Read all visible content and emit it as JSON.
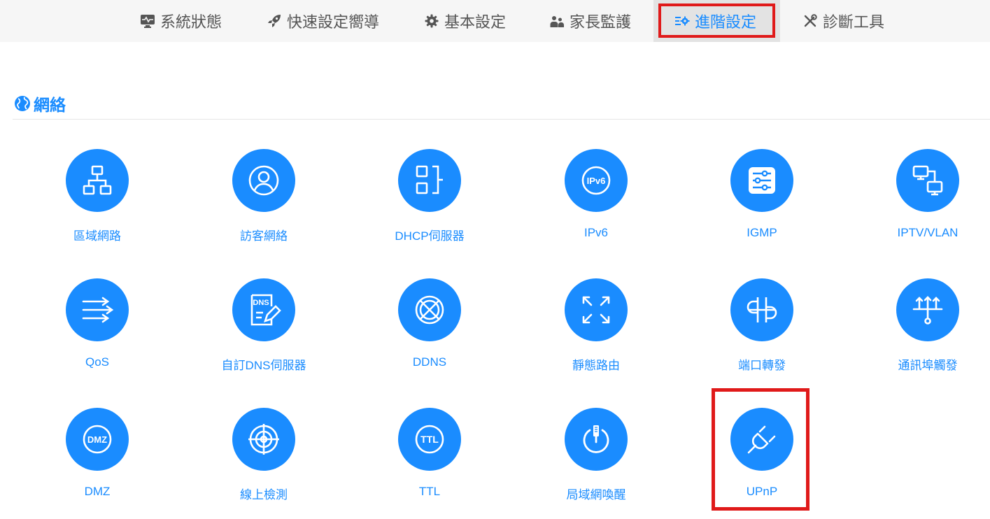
{
  "nav": {
    "items": [
      {
        "label": "系統狀態",
        "icon": "monitor-heartbeat-icon"
      },
      {
        "label": "快速設定嚮導",
        "icon": "rocket-icon"
      },
      {
        "label": "基本設定",
        "icon": "gear-icon"
      },
      {
        "label": "家長監護",
        "icon": "users-icon"
      },
      {
        "label": "進階設定",
        "icon": "advanced-settings-icon",
        "active": true
      },
      {
        "label": "診斷工具",
        "icon": "tools-icon"
      }
    ]
  },
  "section": {
    "title": "網絡",
    "icon": "globe-icon"
  },
  "tiles": [
    {
      "label": "區域網路",
      "icon": "lan-topology-icon"
    },
    {
      "label": "訪客網絡",
      "icon": "guest-user-icon"
    },
    {
      "label": "DHCP伺服器",
      "icon": "dhcp-icon"
    },
    {
      "label": "IPv6",
      "icon": "ipv6-icon",
      "badge": "IPv6"
    },
    {
      "label": "IGMP",
      "icon": "sliders-icon"
    },
    {
      "label": "IPTV/VLAN",
      "icon": "monitors-icon"
    },
    {
      "label": "QoS",
      "icon": "arrows-right-icon"
    },
    {
      "label": "自訂DNS伺服器",
      "icon": "dns-document-icon",
      "badge": "DNS"
    },
    {
      "label": "DDNS",
      "icon": "globe-grid-icon"
    },
    {
      "label": "靜態路由",
      "icon": "expand-arrows-icon"
    },
    {
      "label": "端口轉發",
      "icon": "port-forward-icon"
    },
    {
      "label": "通訊埠觸發",
      "icon": "port-trigger-icon"
    },
    {
      "label": "DMZ",
      "icon": "dmz-icon",
      "badge": "DMZ"
    },
    {
      "label": "線上檢測",
      "icon": "target-radar-icon"
    },
    {
      "label": "TTL",
      "icon": "ttl-icon",
      "badge": "TTL"
    },
    {
      "label": "局域網喚醒",
      "icon": "power-wake-icon"
    },
    {
      "label": "UPnP",
      "icon": "plug-icon",
      "highlighted": true
    }
  ],
  "colors": {
    "accent": "#1a8cff",
    "highlight": "#e01a1a",
    "nav_bg": "#f6f6f6",
    "nav_active_bg": "#e3e3e3"
  }
}
